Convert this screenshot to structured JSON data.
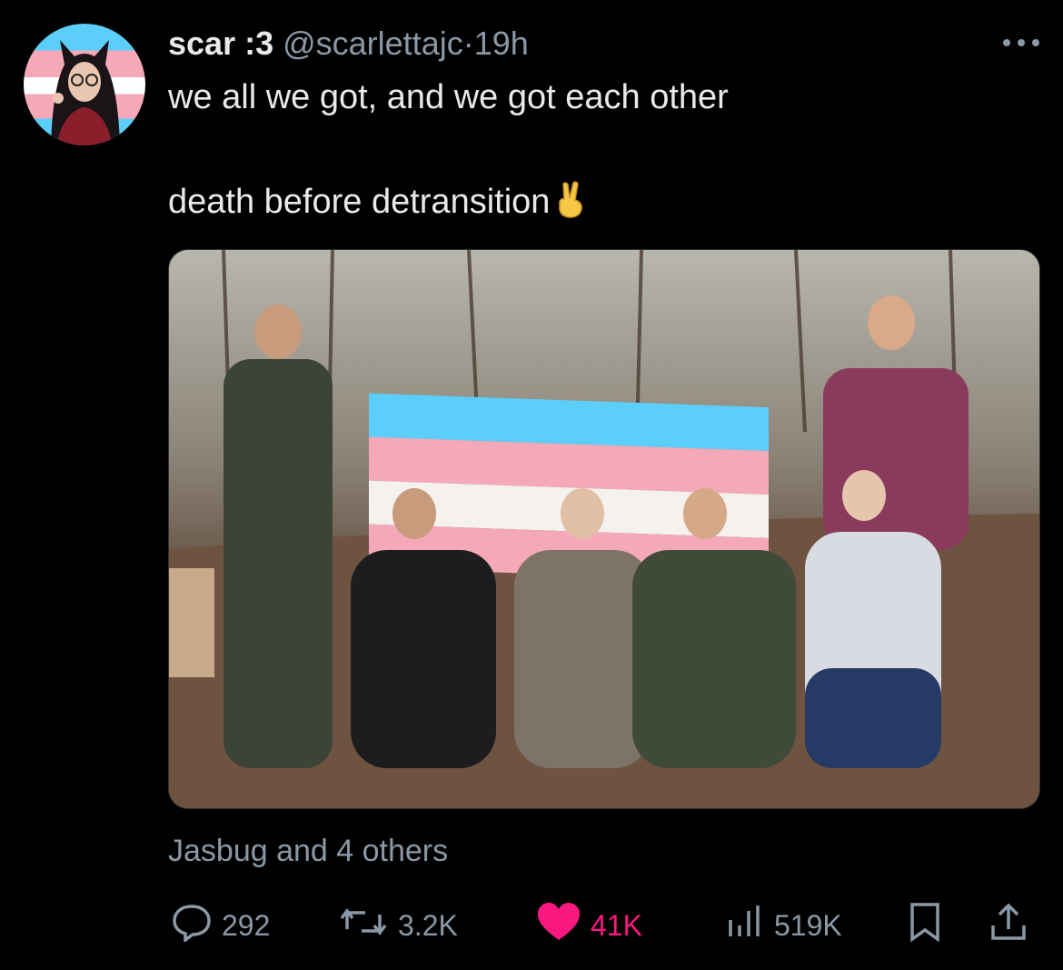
{
  "post": {
    "display_name": "scar :3",
    "handle": "@scarlettajc",
    "separator": "·",
    "time": "19h",
    "more_icon": "more-icon",
    "text_line1": "we all we got, and we got each other",
    "text_line2": "death before detransition",
    "text_emoji": "victory-hand-emoji",
    "liked_by": "Jasbug and 4 others"
  },
  "avatar_flag_colors": [
    "#5bcefa",
    "#f5a9b8",
    "#ffffff"
  ],
  "actions": {
    "replies": "292",
    "reposts": "3.2K",
    "likes": "41K",
    "views": "519K"
  },
  "colors": {
    "like": "#f91880",
    "muted": "#8b98a5",
    "text": "#e7e9ea",
    "background": "#000000"
  }
}
